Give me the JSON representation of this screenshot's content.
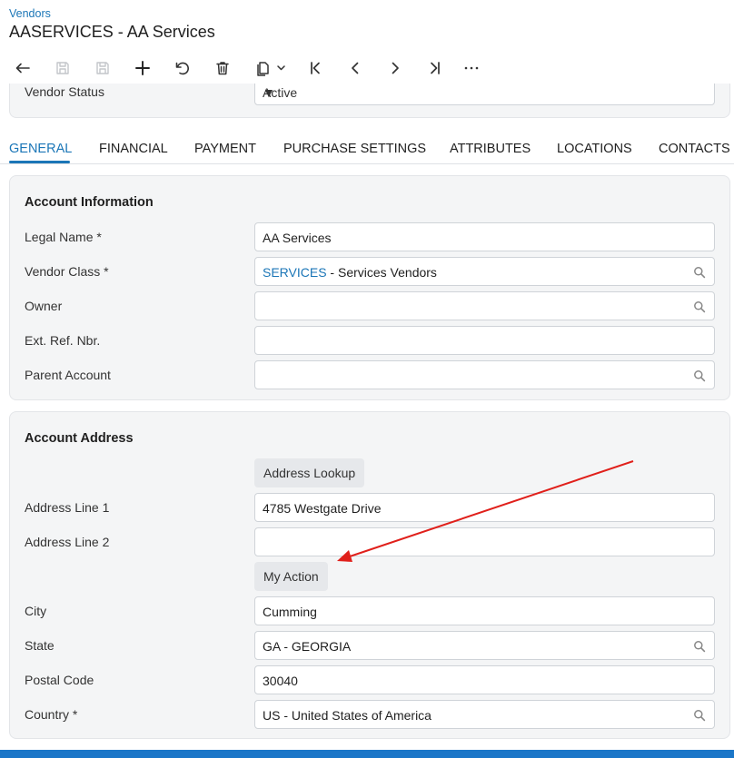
{
  "header": {
    "breadcrumb": "Vendors",
    "title": "AASERVICES - AA Services"
  },
  "toolbar": {
    "icons": [
      "undo-arrow-icon",
      "save-disabled-icon",
      "save-close-disabled-icon",
      "plus-icon",
      "cancel-icon",
      "trash-icon",
      "copy-paste-icon",
      "first-record-icon",
      "previous-record-icon",
      "next-record-icon",
      "last-record-icon",
      "more-icon"
    ]
  },
  "status": {
    "label": "Vendor Status",
    "value": "Active"
  },
  "tabs": [
    {
      "label": "GENERAL",
      "active": true
    },
    {
      "label": "FINANCIAL"
    },
    {
      "label": "PAYMENT"
    },
    {
      "label": "PURCHASE SETTINGS"
    },
    {
      "label": "ATTRIBUTES"
    },
    {
      "label": "LOCATIONS"
    },
    {
      "label": "CONTACTS"
    }
  ],
  "account_info": {
    "title": "Account Information",
    "legal_name": {
      "label": "Legal Name *",
      "value": "AA Services"
    },
    "vendor_class": {
      "label": "Vendor Class *",
      "code": "SERVICES",
      "desc": " - Services Vendors"
    },
    "owner": {
      "label": "Owner",
      "value": ""
    },
    "ext_ref": {
      "label": "Ext. Ref. Nbr.",
      "value": ""
    },
    "parent_account": {
      "label": "Parent Account",
      "value": ""
    }
  },
  "account_address": {
    "title": "Account Address",
    "address_lookup": "Address Lookup",
    "address_line1": {
      "label": "Address Line 1",
      "value": "4785 Westgate Drive"
    },
    "address_line2": {
      "label": "Address Line 2",
      "value": ""
    },
    "my_action": "My Action",
    "city": {
      "label": "City",
      "value": "Cumming"
    },
    "state": {
      "label": "State",
      "value": "GA - GEORGIA"
    },
    "postal_code": {
      "label": "Postal Code",
      "value": "30040"
    },
    "country": {
      "label": "Country *",
      "value": "US - United States of America"
    }
  },
  "colors": {
    "accent": "#1b76b7",
    "annotation_arrow": "#e0201b",
    "card_bg": "#f4f5f6",
    "bottom_bar": "#1b76c8"
  }
}
